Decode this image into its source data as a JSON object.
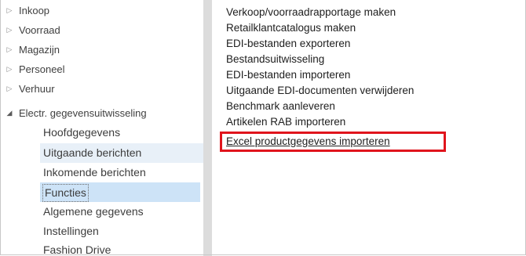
{
  "nav": {
    "items": [
      {
        "label": "Inkoop",
        "expanded": false
      },
      {
        "label": "Voorraad",
        "expanded": false
      },
      {
        "label": "Magazijn",
        "expanded": false
      },
      {
        "label": "Personeel",
        "expanded": false
      },
      {
        "label": "Verhuur",
        "expanded": false
      },
      {
        "label": "Electr. gegevensuitwisseling",
        "expanded": true
      }
    ],
    "subitems": [
      {
        "label": "Hoofdgegevens"
      },
      {
        "label": "Uitgaande berichten"
      },
      {
        "label": "Inkomende berichten"
      },
      {
        "label": "Functies"
      },
      {
        "label": "Algemene gegevens"
      },
      {
        "label": "Instellingen"
      },
      {
        "label": "Fashion Drive"
      }
    ]
  },
  "content": {
    "links": [
      "Verkoop/voorraadrapportage maken",
      "Retailklantcatalogus maken",
      "EDI-bestanden exporteren",
      "Bestandsuitwisseling",
      "EDI-bestanden importeren",
      "Uitgaande EDI-documenten verwijderen",
      "Benchmark aanleveren",
      "Artikelen RAB importeren",
      "Excel productgegevens importeren"
    ]
  },
  "colors": {
    "highlight_border": "#e0141c",
    "selected_bg": "#cde3f7",
    "hover_bg": "#e8f0f8",
    "splitter": "#dcdcdc"
  }
}
